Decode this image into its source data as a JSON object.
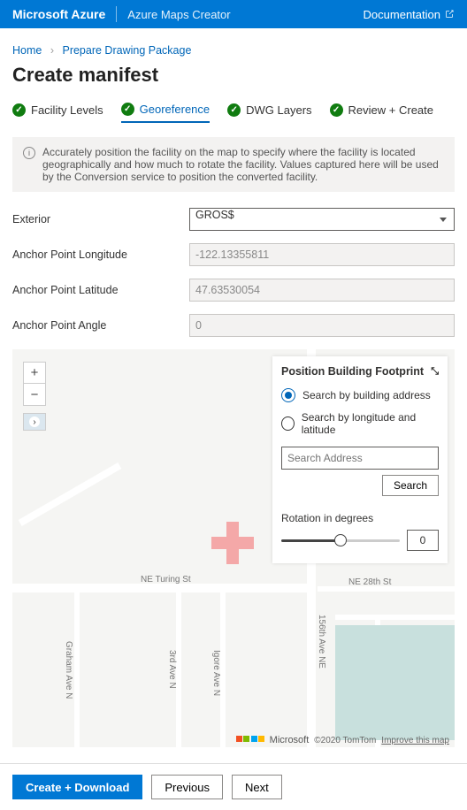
{
  "topbar": {
    "brand": "Microsoft Azure",
    "sub": "Azure Maps Creator",
    "doc": "Documentation"
  },
  "breadcrumb": {
    "home": "Home",
    "current": "Prepare Drawing Package"
  },
  "title": "Create manifest",
  "tabs": {
    "t1": "Facility Levels",
    "t2": "Georeference",
    "t3": "DWG Layers",
    "t4": "Review + Create"
  },
  "info": "Accurately position the facility on the map to specify where the facility is located geographically and how much to rotate the facility. Values captured here will be used by the Conversion service to position the converted facility.",
  "form": {
    "exteriorLabel": "Exterior",
    "exteriorValue": "GROS$",
    "lonLabel": "Anchor Point Longitude",
    "lonValue": "-122.13355811",
    "latLabel": "Anchor Point Latitude",
    "latValue": "47.63530054",
    "angLabel": "Anchor Point Angle",
    "angValue": "0"
  },
  "panel": {
    "title": "Position Building Footprint",
    "opt1": "Search by building address",
    "opt2": "Search by longitude and latitude",
    "searchPlaceholder": "Search Address",
    "searchBtn": "Search",
    "rotLabel": "Rotation in degrees",
    "rotValue": "0"
  },
  "mapLabels": {
    "turing": "NE Turing St",
    "ne28": "NE 28th St",
    "graham": "Graham Ave N",
    "n3rd": "3rd Ave N",
    "igore": "Igore Ave N",
    "a156": "156th Ave NE"
  },
  "attrib": {
    "brand": "Microsoft",
    "copy": "©2020 TomTom",
    "improve": "Improve this map"
  },
  "footer": {
    "primary": "Create + Download",
    "prev": "Previous",
    "next": "Next"
  }
}
